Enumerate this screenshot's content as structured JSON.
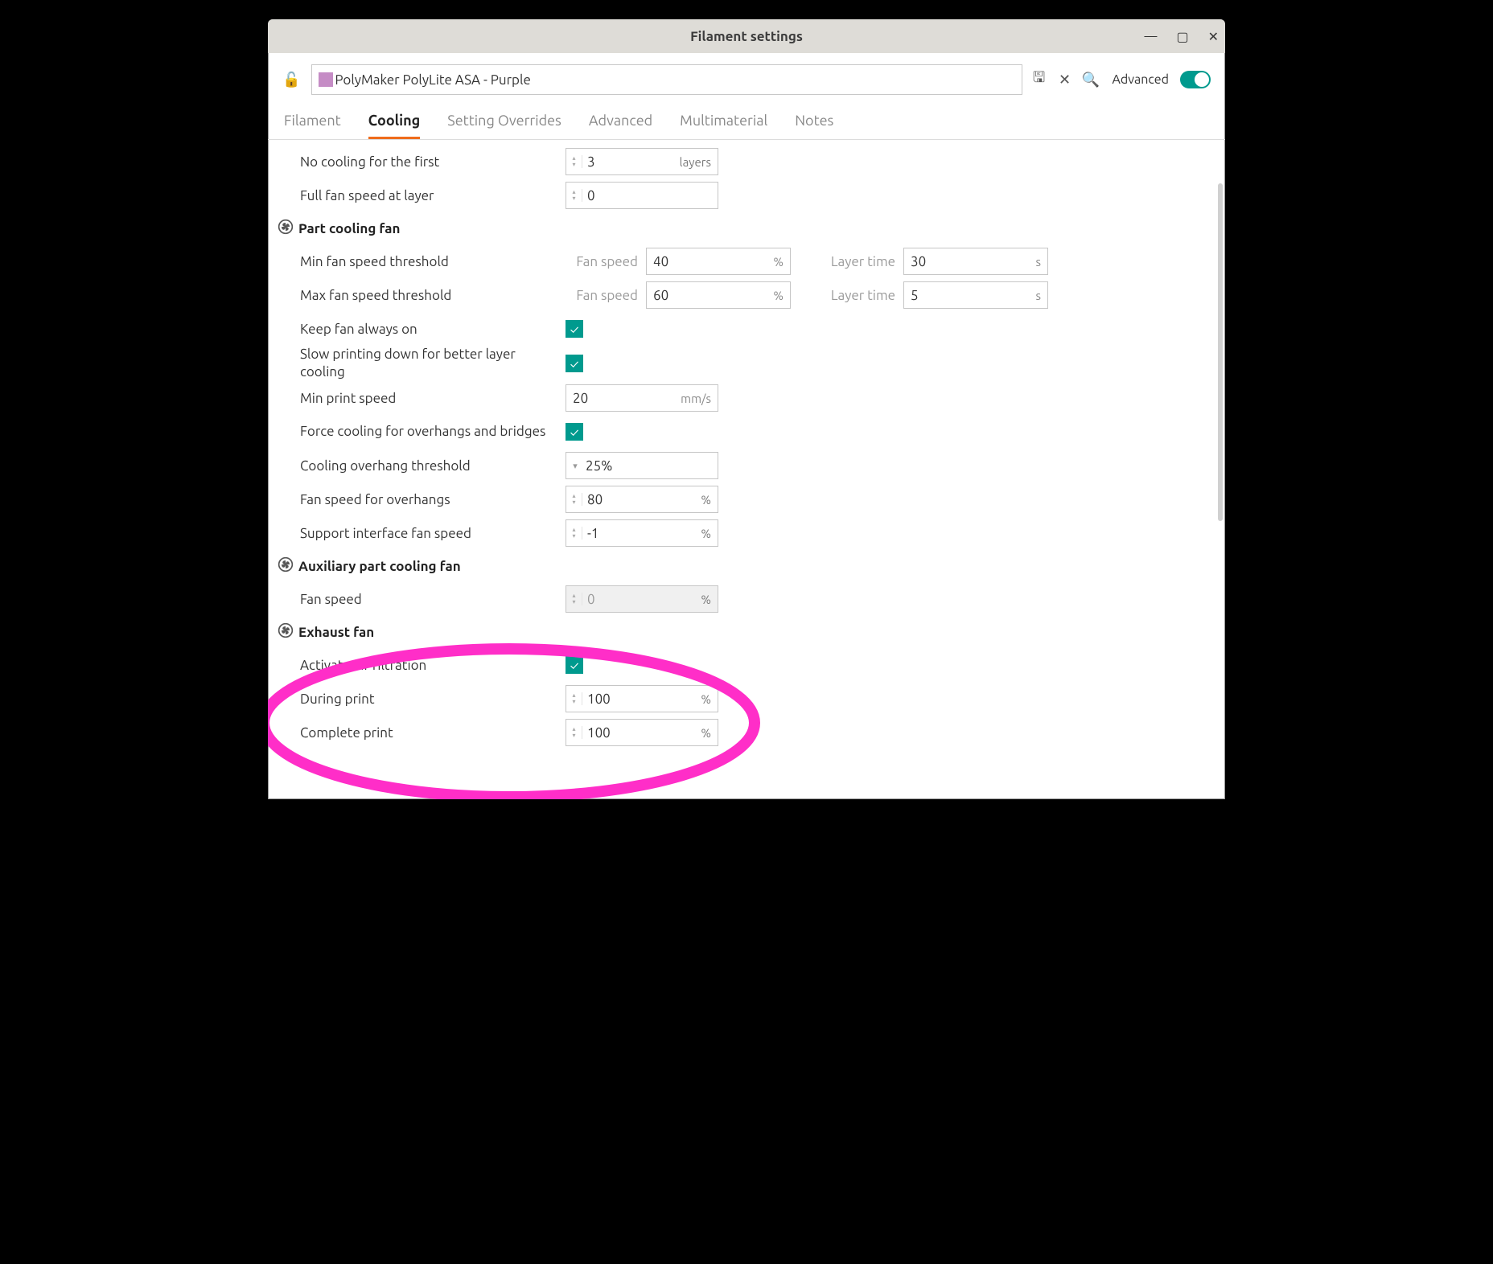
{
  "window": {
    "title": "Filament settings"
  },
  "toolbar": {
    "filament_name": "PolyMaker PolyLite ASA - Purple",
    "advanced_label": "Advanced",
    "swatch_color": "#c58cc5"
  },
  "tabs": [
    "Filament",
    "Cooling",
    "Setting Overrides",
    "Advanced",
    "Multimaterial",
    "Notes"
  ],
  "active_tab": "Cooling",
  "rows": {
    "no_cooling_first": {
      "label": "No cooling for the first",
      "value": "3",
      "unit": "layers"
    },
    "full_fan_layer": {
      "label": "Full fan speed at layer",
      "value": "0",
      "unit": ""
    }
  },
  "part_fan": {
    "title": "Part cooling fan",
    "min_thresh": {
      "label": "Min fan speed threshold",
      "fan_label": "Fan speed",
      "fan_val": "40",
      "fan_unit": "%",
      "layer_label": "Layer time",
      "layer_val": "30",
      "layer_unit": "s"
    },
    "max_thresh": {
      "label": "Max fan speed threshold",
      "fan_label": "Fan speed",
      "fan_val": "60",
      "fan_unit": "%",
      "layer_label": "Layer time",
      "layer_val": "5",
      "layer_unit": "s"
    },
    "keep_on": {
      "label": "Keep fan always on",
      "checked": true
    },
    "slow_print": {
      "label": "Slow printing down for better layer cooling",
      "checked": true
    },
    "min_speed": {
      "label": "Min print speed",
      "value": "20",
      "unit": "mm/s"
    },
    "force_overhang": {
      "label": "Force cooling for overhangs and bridges",
      "checked": true
    },
    "overhang_thresh": {
      "label": "Cooling overhang threshold",
      "value": "25%"
    },
    "overhang_fan": {
      "label": "Fan speed for overhangs",
      "value": "80",
      "unit": "%"
    },
    "support_fan": {
      "label": "Support interface fan speed",
      "value": "-1",
      "unit": "%"
    }
  },
  "aux_fan": {
    "title": "Auxiliary part cooling fan",
    "speed": {
      "label": "Fan speed",
      "value": "0",
      "unit": "%"
    }
  },
  "exhaust": {
    "title": "Exhaust fan",
    "activate": {
      "label": "Activate air filtration",
      "checked": true
    },
    "during": {
      "label": "During print",
      "value": "100",
      "unit": "%"
    },
    "complete": {
      "label": "Complete print",
      "value": "100",
      "unit": "%"
    }
  }
}
